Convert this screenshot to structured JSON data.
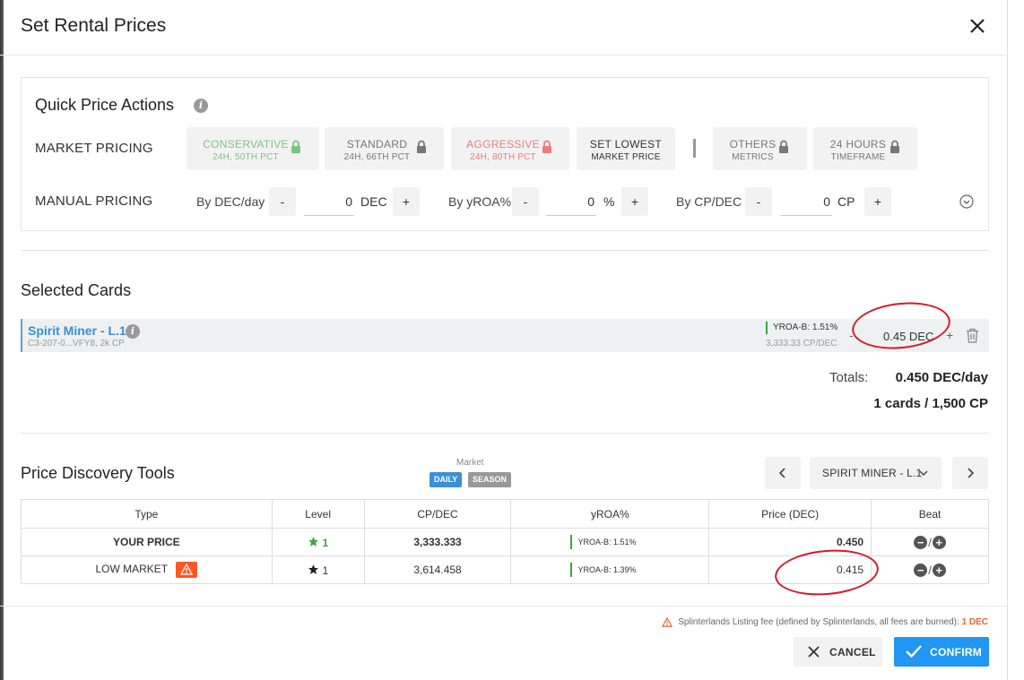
{
  "dialog": {
    "title": "Set Rental Prices"
  },
  "quick_price_actions": {
    "title": "Quick Price Actions",
    "market_pricing_label": "MARKET PRICING",
    "manual_pricing_label": "MANUAL PRICING",
    "presets": [
      {
        "label": "CONSERVATIVE",
        "sub": "24H, 50TH PCT",
        "locked": true,
        "color": "#7bc47f"
      },
      {
        "label": "STANDARD",
        "sub": "24H, 66TH PCT",
        "locked": true,
        "color": "#777777"
      },
      {
        "label": "AGGRESSIVE",
        "sub": "24H, 80TH PCT",
        "locked": true,
        "color": "#ec7b7b"
      },
      {
        "label": "SET LOWEST",
        "sub": "MARKET PRICE",
        "locked": false,
        "color": "#333333"
      },
      {
        "label": "OTHERS",
        "sub": "METRICS",
        "locked": true,
        "color": "#777777"
      },
      {
        "label": "24 HOURS",
        "sub": "TIMEFRAME",
        "locked": true,
        "color": "#777777"
      }
    ],
    "manual": {
      "dec": {
        "label": "By DEC/day",
        "minus": "-",
        "value": "0",
        "unit": "DEC",
        "plus": "+"
      },
      "yroa": {
        "label": "By yROA%",
        "minus": "-",
        "value": "0",
        "unit": "%",
        "plus": "+"
      },
      "cp": {
        "label": "By CP/DEC",
        "minus": "-",
        "value": "0",
        "unit": "CP",
        "plus": "+"
      }
    }
  },
  "selected_cards": {
    "title": "Selected Cards",
    "card": {
      "name": "Spirit Miner - L.1",
      "sub": "C3-207-0...VFY8, 2k CP",
      "yroa": "YROA-B: 1.51%",
      "cp_dec": "3,333.33 CP/DEC",
      "minus": "-",
      "price": "0.45  DEC",
      "plus": "+"
    },
    "totals_label": "Totals:",
    "totals_value": "0.450 DEC/day",
    "totals_count": "1 cards / 1,500 CP"
  },
  "price_discovery": {
    "title": "Price Discovery Tools",
    "market_label": "Market",
    "tag_daily": "DAILY",
    "tag_season": "SEASON",
    "card_select": "SPIRIT MINER - L.1",
    "columns": [
      "Type",
      "Level",
      "CP/DEC",
      "yROA%",
      "Price (DEC)",
      "Beat"
    ],
    "rows": [
      {
        "type": "YOUR PRICE",
        "level": "1",
        "cp_dec": "3,333.333",
        "yroa": "YROA-B: 1.51%",
        "price": "0.450",
        "slash": "/"
      },
      {
        "type": "LOW MARKET",
        "level": "1",
        "cp_dec": "3,614.458",
        "yroa": "YROA-B: 1.39%",
        "price": "0.415",
        "slash": "/"
      }
    ]
  },
  "footer": {
    "fee_note": "Splinterlands Listing fee (defined by Splinterlands, all fees are burned):",
    "fee_value": "1 DEC",
    "cancel_label": "CANCEL",
    "confirm_label": "CONFIRM"
  },
  "colors": {
    "accent": "#2196f3",
    "green": "#38a83b",
    "warning": "#ff5722",
    "annotation": "#d9182a"
  }
}
